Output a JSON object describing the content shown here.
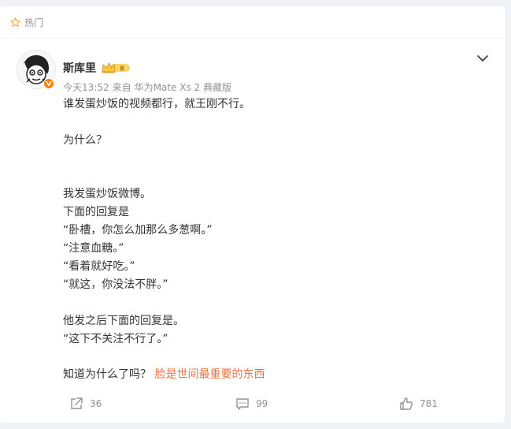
{
  "section": {
    "label": "热门",
    "icon": "star-outline-icon"
  },
  "post": {
    "author": "斯库里",
    "level_badge": "Ⅱ",
    "time": "今天13:52",
    "source_prefix": "来自",
    "source": "华为Mate Xs 2 典藏版",
    "lines": [
      "谁发蛋炒饭的视频都行，就王刚不行。",
      "",
      "为什么？",
      "",
      "",
      "我发蛋炒饭微博。",
      "下面的回复是",
      "“卧槽，你怎么加那么多葱啊。”",
      "“注意血糖。”",
      "“看着就好吃。”",
      "“就这，你没法不胖。”",
      "",
      "他发之后下面的回复是。",
      "“这下不关注不行了。”",
      ""
    ],
    "last_line_text": "知道为什么了吗？",
    "last_line_link": "脸是世间最重要的东西"
  },
  "actions": {
    "share_count": "36",
    "comment_count": "99",
    "like_count": "781"
  },
  "colors": {
    "accent": "#ff8200",
    "link": "#eb7340",
    "muted": "#939393",
    "text": "#333333"
  }
}
